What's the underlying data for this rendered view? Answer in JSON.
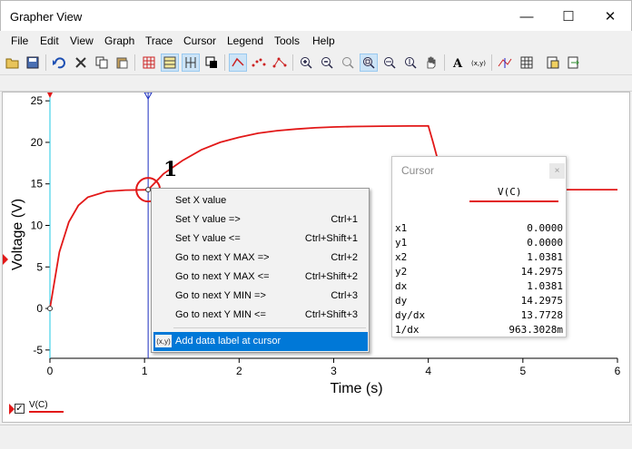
{
  "window": {
    "title": "Grapher View",
    "minimize_glyph": "—",
    "maximize_glyph": "☐",
    "close_glyph": "✕"
  },
  "menu": [
    "File",
    "Edit",
    "View",
    "Graph",
    "Trace",
    "Cursor",
    "Legend",
    "Tools",
    "Help"
  ],
  "toolbar": {
    "icons": [
      "open-icon",
      "save-icon",
      "undo-icon",
      "delete-icon",
      "copy-icon",
      "paste-icon",
      "grid-icon",
      "plot-area-icon",
      "stack-icon",
      "window-icon",
      "line-icon",
      "points-icon",
      "line-points-icon",
      "zoom-in-icon",
      "zoom-out-icon",
      "zoom-fit-icon",
      "zoom-window-icon",
      "zoom-x-icon",
      "zoom-y-icon",
      "pan-icon",
      "text-icon",
      "data-label-icon",
      "cursor-icon",
      "table-icon",
      "export-icon"
    ]
  },
  "chart_data": {
    "type": "line",
    "xlabel": "Time (s)",
    "ylabel": "Voltage (V)",
    "xlim": [
      0,
      6
    ],
    "ylim": [
      -6,
      26
    ],
    "x_ticks": [
      "0",
      "1",
      "2",
      "3",
      "4",
      "5",
      "6"
    ],
    "y_ticks": [
      "-5",
      "0",
      "5",
      "10",
      "15",
      "20",
      "25"
    ],
    "grid": false,
    "series": [
      {
        "name": "V(C)",
        "color": "#e21818",
        "x": [
          0,
          0.1,
          0.2,
          0.3,
          0.4,
          0.6,
          0.8,
          1.0,
          1.0381,
          1.2,
          1.4,
          1.6,
          1.8,
          2.0,
          2.2,
          2.4,
          2.6,
          2.8,
          3.0,
          3.2,
          3.5,
          3.8,
          4.0,
          4.05,
          4.1,
          4.2,
          4.3,
          4.5,
          5.0,
          6.0
        ],
        "y": [
          0,
          6.8,
          10.4,
          12.4,
          13.4,
          14.1,
          14.25,
          14.28,
          14.2975,
          16.2,
          17.8,
          19.1,
          20.0,
          20.6,
          21.1,
          21.4,
          21.6,
          21.75,
          21.85,
          21.9,
          21.95,
          21.97,
          21.98,
          20.0,
          17.9,
          15.6,
          14.7,
          14.35,
          14.3,
          14.3
        ]
      }
    ],
    "cursors": [
      {
        "name": "cursor-1",
        "x": 0.0,
        "color": "#1ec8e6"
      },
      {
        "name": "cursor-2",
        "x": 1.0381,
        "color": "#1c2fbf"
      }
    ],
    "annotation": {
      "label": "1",
      "x": 1.0381,
      "y": 14.2975
    }
  },
  "legend": {
    "name": "V(C)",
    "checked": "✓"
  },
  "context_menu": [
    {
      "label": "Set X value",
      "shortcut": ""
    },
    {
      "label": "Set Y value =>",
      "shortcut": "Ctrl+1"
    },
    {
      "label": "Set Y value <=",
      "shortcut": "Ctrl+Shift+1"
    },
    {
      "label": "Go to next Y MAX =>",
      "shortcut": "Ctrl+2"
    },
    {
      "label": "Go to next Y MAX <=",
      "shortcut": "Ctrl+Shift+2"
    },
    {
      "label": "Go to next Y MIN =>",
      "shortcut": "Ctrl+3"
    },
    {
      "label": "Go to next Y MIN <=",
      "shortcut": "Ctrl+Shift+3"
    }
  ],
  "context_menu_highlight": {
    "label": "Add data label at cursor",
    "icon": "(x,y)"
  },
  "cursor_window": {
    "title": "Cursor",
    "close_glyph": "×",
    "column": "V(C)",
    "rows": [
      {
        "k": "x1",
        "v": "0.0000"
      },
      {
        "k": "y1",
        "v": "0.0000"
      },
      {
        "k": "x2",
        "v": "1.0381"
      },
      {
        "k": "y2",
        "v": "14.2975"
      },
      {
        "k": "dx",
        "v": "1.0381"
      },
      {
        "k": "dy",
        "v": "14.2975"
      },
      {
        "k": "dy/dx",
        "v": "13.7728"
      },
      {
        "k": "1/dx",
        "v": "963.3028m"
      }
    ]
  }
}
